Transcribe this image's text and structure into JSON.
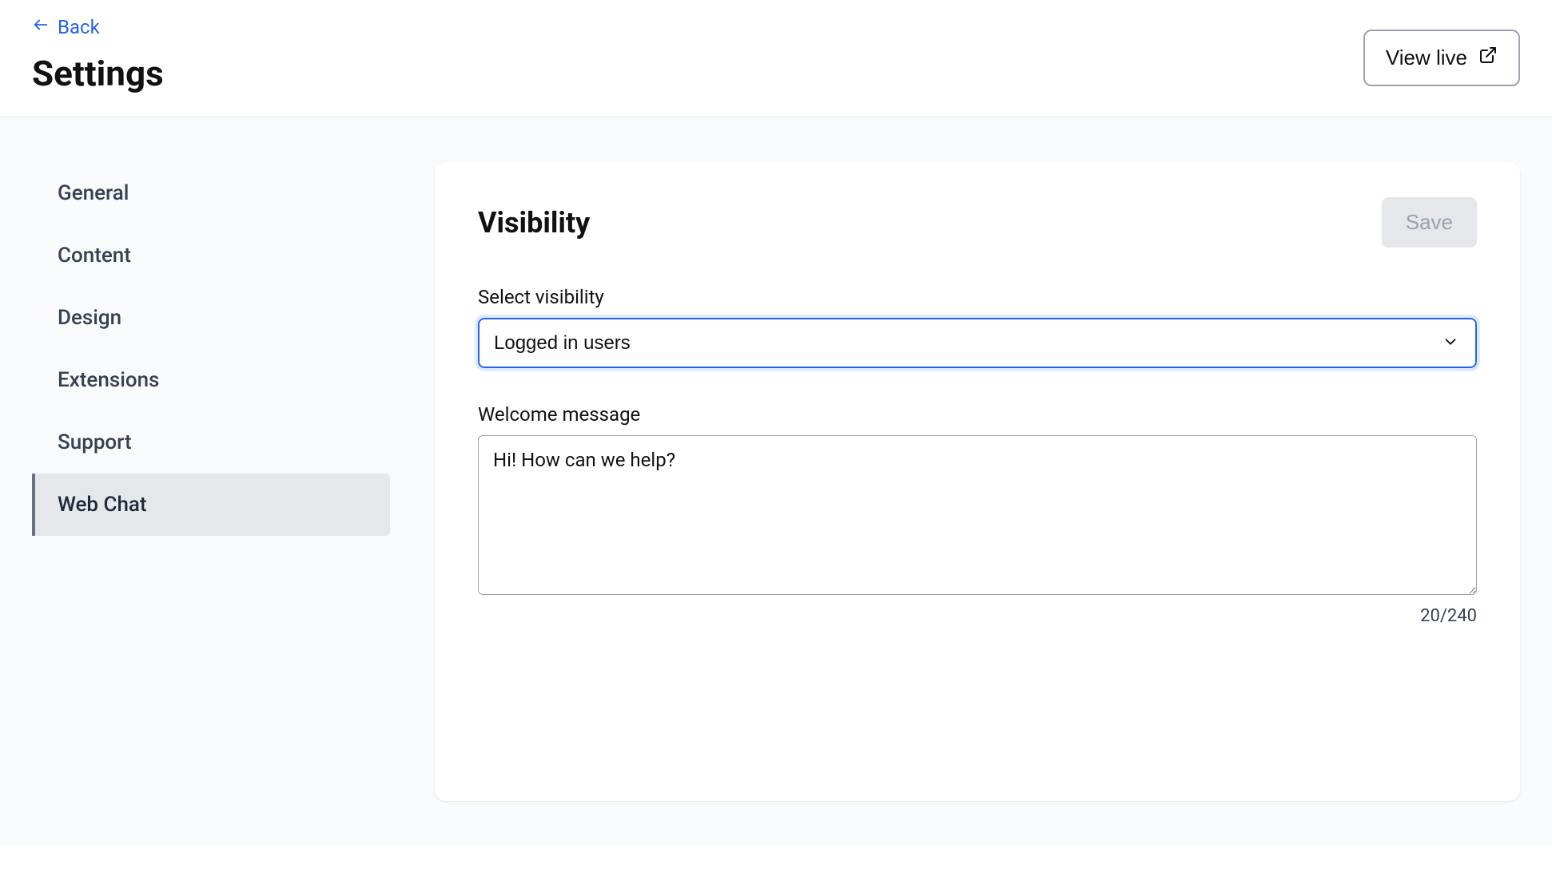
{
  "header": {
    "back_label": "Back",
    "page_title": "Settings",
    "view_live_label": "View live"
  },
  "sidebar": {
    "items": [
      {
        "label": "General",
        "active": false
      },
      {
        "label": "Content",
        "active": false
      },
      {
        "label": "Design",
        "active": false
      },
      {
        "label": "Extensions",
        "active": false
      },
      {
        "label": "Support",
        "active": false
      },
      {
        "label": "Web Chat",
        "active": true
      }
    ]
  },
  "panel": {
    "title": "Visibility",
    "save_label": "Save",
    "visibility": {
      "label": "Select visibility",
      "value": "Logged in users"
    },
    "welcome_message": {
      "label": "Welcome message",
      "value": "Hi! How can we help?",
      "counter": "20/240"
    }
  }
}
